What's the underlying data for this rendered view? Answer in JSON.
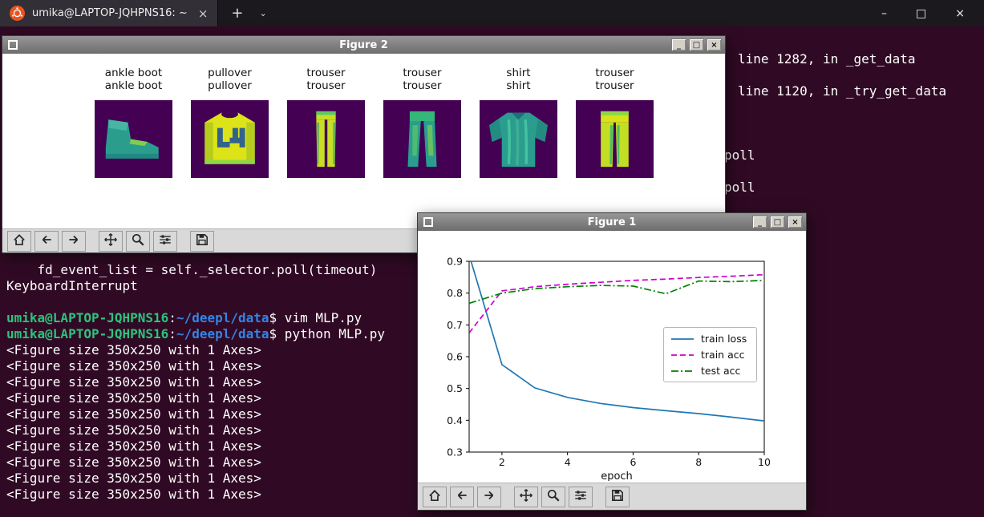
{
  "terminal": {
    "header": {
      "tab_title": "umika@LAPTOP-JQHPNS16: ~",
      "tab_close_glyph": "×",
      "new_tab_glyph": "+",
      "tab_list_glyph": "⌄",
      "minimize_glyph": "–",
      "maximize_glyph": "□",
      "close_glyph": "×"
    },
    "right_fragments": [
      "line 1282, in _get_data",
      "line 1120, in _try_get_data",
      "poll",
      "poll"
    ],
    "lines": {
      "traceback": "    fd_event_list = self._selector.poll(timeout)",
      "interrupt": "KeyboardInterrupt"
    },
    "prompts": [
      {
        "user": "umika@LAPTOP-JQHPNS16",
        "colon": ":",
        "path": "~/deepl/data",
        "dollar": "$",
        "command": " vim MLP.py"
      },
      {
        "user": "umika@LAPTOP-JQHPNS16",
        "colon": ":",
        "path": "~/deepl/data",
        "dollar": "$",
        "command": " python MLP.py"
      }
    ],
    "output_lines": [
      "<Figure size 350x250 with 1 Axes>",
      "<Figure size 350x250 with 1 Axes>",
      "<Figure size 350x250 with 1 Axes>",
      "<Figure size 350x250 with 1 Axes>",
      "<Figure size 350x250 with 1 Axes>",
      "<Figure size 350x250 with 1 Axes>",
      "<Figure size 350x250 with 1 Axes>",
      "<Figure size 350x250 with 1 Axes>",
      "<Figure size 350x250 with 1 Axes>",
      "<Figure size 350x250 with 1 Axes>"
    ],
    "colors": {
      "background": "#300a24",
      "user_green": "#2ec27e",
      "path_blue": "#3584e4",
      "text": "#ffffff"
    }
  },
  "figure2": {
    "title": "Figure 2",
    "controls": {
      "minimize": "_",
      "maximize": "□",
      "close": "×"
    },
    "samples": [
      {
        "line1": "ankle boot",
        "line2": "ankle boot"
      },
      {
        "line1": "pullover",
        "line2": "pullover"
      },
      {
        "line1": "trouser",
        "line2": "trouser"
      },
      {
        "line1": "trouser",
        "line2": "trouser"
      },
      {
        "line1": "shirt",
        "line2": "shirt"
      },
      {
        "line1": "trouser",
        "line2": "trouser"
      }
    ],
    "toolbar_icons": [
      "home",
      "back",
      "forward",
      "pan",
      "zoom",
      "configure",
      "save"
    ]
  },
  "figure1": {
    "title": "Figure 1",
    "controls": {
      "minimize": "_",
      "maximize": "□",
      "close": "×"
    },
    "toolbar_icons": [
      "home",
      "back",
      "forward",
      "pan",
      "zoom",
      "configure",
      "save"
    ]
  },
  "chart_data": {
    "type": "line",
    "x": [
      1,
      2,
      3,
      4,
      5,
      6,
      7,
      8,
      9,
      10
    ],
    "series": [
      {
        "name": "train loss",
        "color": "#1f77b4",
        "style": "solid",
        "values": [
          0.92,
          0.575,
          0.502,
          0.472,
          0.453,
          0.44,
          0.43,
          0.421,
          0.41,
          0.398
        ]
      },
      {
        "name": "train acc",
        "color": "#cc00cc",
        "style": "dashed",
        "values": [
          0.675,
          0.807,
          0.82,
          0.828,
          0.834,
          0.84,
          0.844,
          0.849,
          0.853,
          0.858
        ]
      },
      {
        "name": "test acc",
        "color": "#008000",
        "style": "dashdot",
        "values": [
          0.768,
          0.8,
          0.814,
          0.82,
          0.824,
          0.822,
          0.798,
          0.838,
          0.836,
          0.84
        ]
      }
    ],
    "xlabel": "epoch",
    "ylabel": "",
    "xlim": [
      1,
      10
    ],
    "ylim": [
      0.3,
      0.9
    ],
    "xticks": [
      2,
      4,
      6,
      8,
      10
    ],
    "yticks": [
      0.3,
      0.4,
      0.5,
      0.6,
      0.7,
      0.8,
      0.9
    ],
    "legend_position": "center right",
    "grid": false
  }
}
